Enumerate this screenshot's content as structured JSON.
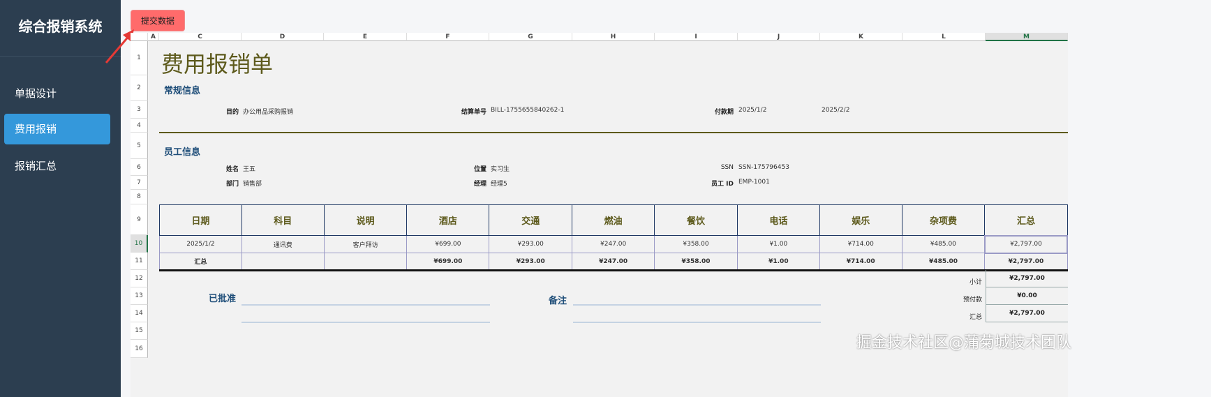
{
  "sidebar": {
    "title": "综合报销系统",
    "items": [
      {
        "label": "单据设计"
      },
      {
        "label": "费用报销"
      },
      {
        "label": "报销汇总"
      }
    ]
  },
  "toolbar": {
    "submit_label": "提交数据"
  },
  "sheet": {
    "columns": [
      "A",
      "C",
      "D",
      "E",
      "F",
      "G",
      "H",
      "I",
      "J",
      "K",
      "L",
      "M"
    ],
    "rows": [
      "1",
      "2",
      "3",
      "4",
      "5",
      "6",
      "7",
      "8",
      "9",
      "10",
      "11",
      "12",
      "13",
      "14",
      "15",
      "16"
    ],
    "title": "费用报销单",
    "general": {
      "heading": "常规信息",
      "purpose_label": "目的",
      "purpose": "办公用品采购报销",
      "bill_label": "结算单号",
      "bill": "BILL-1755655840262-1",
      "period_label": "付款期",
      "period_start": "2025/1/2",
      "period_end": "2025/2/2"
    },
    "employee": {
      "heading": "员工信息",
      "name_label": "姓名",
      "name": "王五",
      "position_label": "位置",
      "position": "实习生",
      "ssn_label": "SSN",
      "ssn": "SSN-175796453",
      "dept_label": "部门",
      "dept": "销售部",
      "manager_label": "经理",
      "manager": "经理5",
      "empid_label": "员工 ID",
      "empid": "EMP-1001"
    },
    "table": {
      "headers": [
        "日期",
        "科目",
        "说明",
        "酒店",
        "交通",
        "燃油",
        "餐饮",
        "电话",
        "娱乐",
        "杂项费",
        "汇总"
      ],
      "rows": [
        [
          "2025/1/2",
          "通讯费",
          "客户拜访",
          "¥699.00",
          "¥293.00",
          "¥247.00",
          "¥358.00",
          "¥1.00",
          "¥714.00",
          "¥485.00",
          "¥2,797.00"
        ]
      ],
      "total": [
        "汇总",
        "",
        "",
        "¥699.00",
        "¥293.00",
        "¥247.00",
        "¥358.00",
        "¥1.00",
        "¥714.00",
        "¥485.00",
        "¥2,797.00"
      ]
    },
    "summary": {
      "subtotal_label": "小计",
      "subtotal": "¥2,797.00",
      "advance_label": "预付款",
      "advance": "¥0.00",
      "total_label": "汇总",
      "total": "¥2,797.00"
    },
    "approved_label": "已批准",
    "notes_label": "备注"
  },
  "watermark": "掘金技术社区@蒲菊城技术团队"
}
